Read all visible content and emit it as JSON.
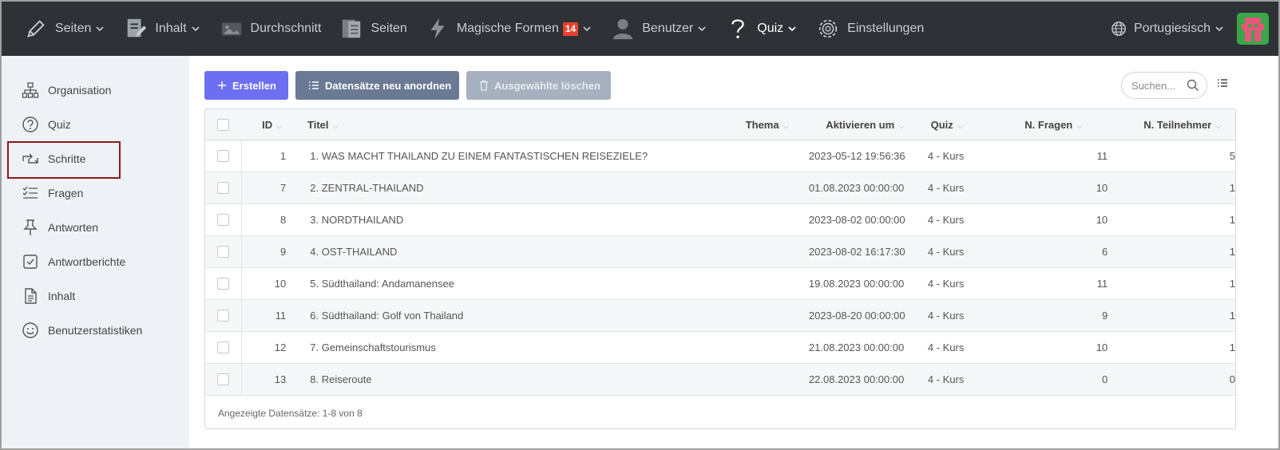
{
  "topbar": {
    "items": [
      {
        "label": "Seiten",
        "icon": "pencil-icon",
        "dropdown": true
      },
      {
        "label": "Inhalt",
        "icon": "document-edit-icon",
        "dropdown": true
      },
      {
        "label": "Durchschnitt",
        "icon": "image-icon",
        "dropdown": false
      },
      {
        "label": "Seiten",
        "icon": "pages-icon",
        "dropdown": false
      },
      {
        "label": "Magische Formen",
        "icon": "lightning-icon",
        "dropdown": true,
        "badge": "14"
      },
      {
        "label": "Benutzer",
        "icon": "user-icon",
        "dropdown": true
      },
      {
        "label": "Quiz",
        "icon": "question-icon",
        "dropdown": true,
        "active": true
      },
      {
        "label": "Einstellungen",
        "icon": "gear-icon",
        "dropdown": false
      }
    ],
    "language": "Portugiesisch",
    "colors": {
      "background": "#2e3236",
      "badge": "#e8412e",
      "avatar": "#3aa64a"
    }
  },
  "sidebar": {
    "items": [
      {
        "label": "Organisation",
        "icon": "sitemap-icon"
      },
      {
        "label": "Quiz",
        "icon": "question-circle-icon"
      },
      {
        "label": "Schritte",
        "icon": "steps-arrows-icon",
        "highlighted": true
      },
      {
        "label": "Fragen",
        "icon": "checklist-icon"
      },
      {
        "label": "Antworten",
        "icon": "pin-icon"
      },
      {
        "label": "Antwortberichte",
        "icon": "checkbox-icon"
      },
      {
        "label": "Inhalt",
        "icon": "file-icon"
      },
      {
        "label": "Benutzerstatistiken",
        "icon": "smiley-icon"
      }
    ]
  },
  "toolbar": {
    "create_label": "Erstellen",
    "reorder_label": "Datensätze neu anordnen",
    "delete_label": "Ausgewählte löschen",
    "search_placeholder": "Suchen...",
    "colors": {
      "primary": "#6d6ff3",
      "secondary": "#6b7a94",
      "disabled": "#a7b0bf"
    }
  },
  "table": {
    "columns": {
      "id": "ID",
      "title": "Titel",
      "thema": "Thema",
      "aktivieren": "Aktivieren um",
      "quiz": "Quiz",
      "fragen": "N. Fragen",
      "teilnehmer": "N. Teilnehmer"
    },
    "rows": [
      {
        "id": "1",
        "title": "1. WAS MACHT THAILAND ZU EINEM FANTASTISCHEN REISEZIELE?",
        "thema": "",
        "aktivieren": "2023-05-12 19:56:36",
        "quiz": "4 - Kurs",
        "fragen": "11",
        "teilnehmer": "5"
      },
      {
        "id": "7",
        "title": "2. ZENTRAL-THAILAND",
        "thema": "",
        "aktivieren": "01.08.2023 00:00:00",
        "quiz": "4 - Kurs",
        "fragen": "10",
        "teilnehmer": "1"
      },
      {
        "id": "8",
        "title": "3. NORDTHAILAND",
        "thema": "",
        "aktivieren": "2023-08-02 00:00:00",
        "quiz": "4 - Kurs",
        "fragen": "10",
        "teilnehmer": "1"
      },
      {
        "id": "9",
        "title": "4. OST-THAILAND",
        "thema": "",
        "aktivieren": "2023-08-02 16:17:30",
        "quiz": "4 - Kurs",
        "fragen": "6",
        "teilnehmer": "1"
      },
      {
        "id": "10",
        "title": "5. Südthailand: Andamanensee",
        "thema": "",
        "aktivieren": "19.08.2023 00:00:00",
        "quiz": "4 - Kurs",
        "fragen": "11",
        "teilnehmer": "1"
      },
      {
        "id": "11",
        "title": "6. Südthailand: Golf von Thailand",
        "thema": "",
        "aktivieren": "2023-08-20 00:00:00",
        "quiz": "4 - Kurs",
        "fragen": "9",
        "teilnehmer": "1"
      },
      {
        "id": "12",
        "title": "7. Gemeinschaftstourismus",
        "thema": "",
        "aktivieren": "21.08.2023 00:00:00",
        "quiz": "4 - Kurs",
        "fragen": "10",
        "teilnehmer": "1"
      },
      {
        "id": "13",
        "title": "8. Reiseroute",
        "thema": "",
        "aktivieren": "22.08.2023 00:00:00",
        "quiz": "4 - Kurs",
        "fragen": "0",
        "teilnehmer": "0"
      }
    ],
    "footer": "Angezeigte Datensätze: 1-8 von 8"
  }
}
